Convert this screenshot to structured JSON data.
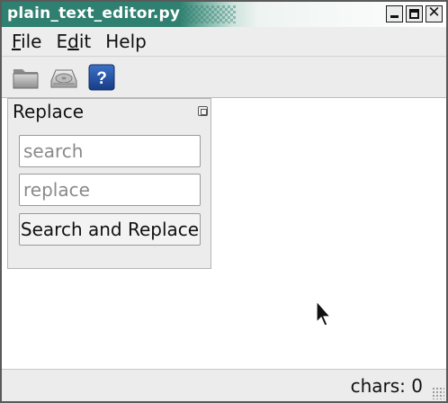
{
  "window": {
    "title": "plain_text_editor.py",
    "controls": [
      "minimize-icon",
      "maximize-icon",
      "close-icon"
    ],
    "close_glyph": "✕"
  },
  "menu": {
    "items": [
      {
        "pre": "",
        "mnemonic": "F",
        "post": "ile"
      },
      {
        "pre": "E",
        "mnemonic": "d",
        "post": "it"
      },
      {
        "pre": "Help",
        "mnemonic": "",
        "post": ""
      }
    ]
  },
  "toolbar": {
    "buttons": [
      "folder-open-icon",
      "save-disk-icon",
      "help-icon"
    ],
    "help_glyph": "?"
  },
  "replace_panel": {
    "title": "Replace",
    "search_placeholder": "search",
    "search_value": "",
    "replace_placeholder": "replace",
    "replace_value": "",
    "button_label": "Search and Replace"
  },
  "editor": {
    "content": ""
  },
  "status": {
    "text": "chars: 0"
  },
  "colors": {
    "titlebar": "#2f8070",
    "help_icon": "#1f4f9e"
  }
}
